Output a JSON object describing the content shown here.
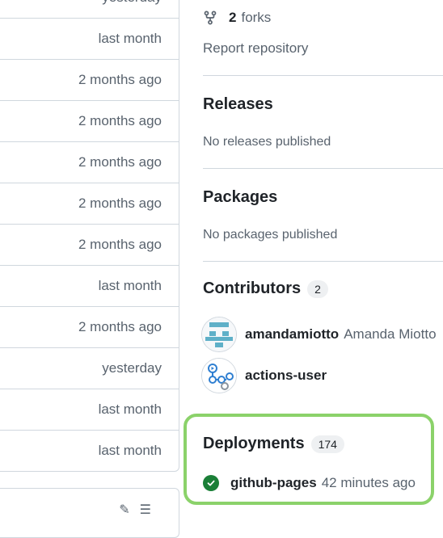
{
  "file_table": {
    "rows": [
      {
        "time": "yesterday"
      },
      {
        "time": "last month"
      },
      {
        "time": "2 months ago"
      },
      {
        "time": "2 months ago"
      },
      {
        "time": "2 months ago"
      },
      {
        "time": "2 months ago"
      },
      {
        "time": "2 months ago"
      },
      {
        "time": "last month"
      },
      {
        "time": "2 months ago"
      },
      {
        "time": "yesterday"
      },
      {
        "time": "last month"
      },
      {
        "time": "last month"
      }
    ]
  },
  "sidebar": {
    "forks_count": "2",
    "forks_label": "forks",
    "report_label": "Report repository",
    "releases": {
      "title": "Releases",
      "empty_text": "No releases published"
    },
    "packages": {
      "title": "Packages",
      "empty_text": "No packages published"
    },
    "contributors": {
      "title": "Contributors",
      "count": "2",
      "items": [
        {
          "login": "amandamiotto",
          "name": "Amanda Miotto"
        },
        {
          "login": "actions-user",
          "name": ""
        }
      ]
    },
    "deployments": {
      "title": "Deployments",
      "count": "174",
      "items": [
        {
          "environment": "github-pages",
          "time": "42 minutes ago",
          "status": "success"
        }
      ]
    }
  },
  "colors": {
    "highlight": "#8bd26a",
    "success": "#1a7f37",
    "muted_text": "#59636e"
  }
}
